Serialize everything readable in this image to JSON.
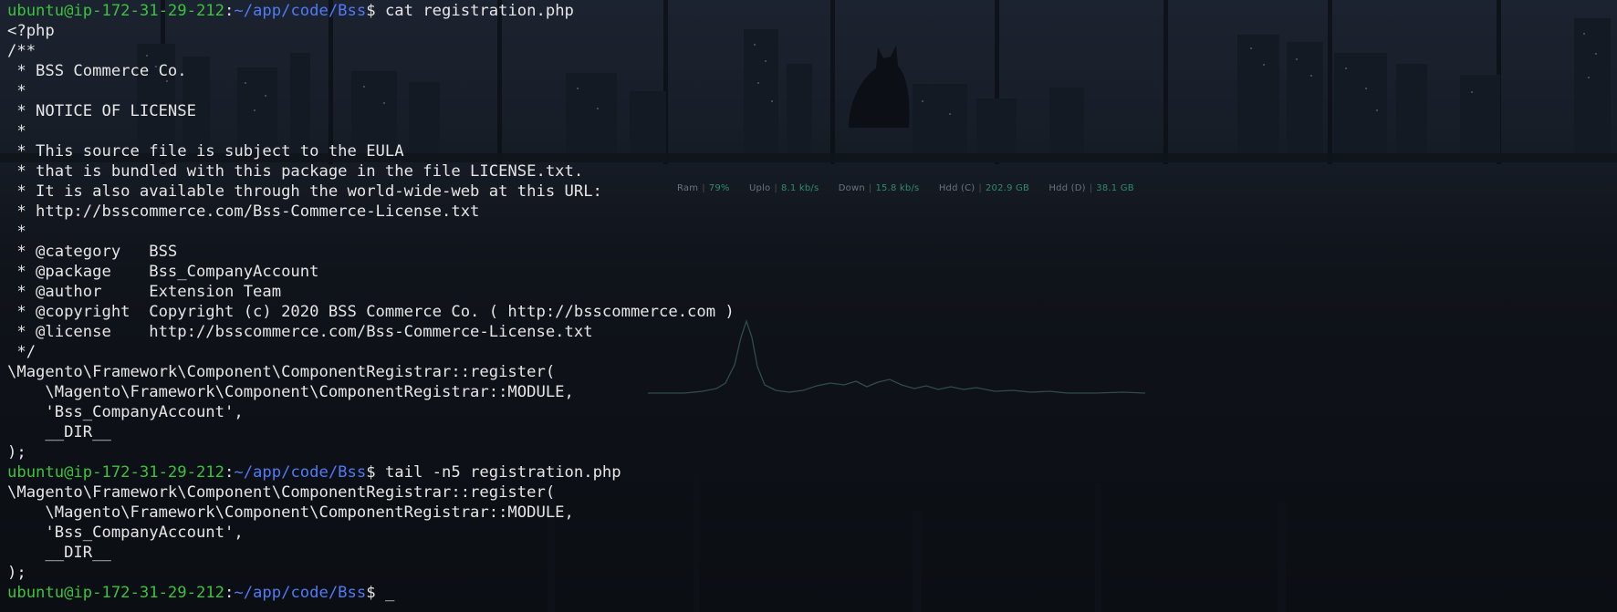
{
  "terminal": {
    "prompt": {
      "user_host": "ubuntu@ip-172-31-29-212",
      "colon": ":",
      "path": "~/app/code/Bss",
      "dollar": "$ "
    },
    "lines": [
      {
        "type": "prompt",
        "command": "cat registration.php"
      },
      {
        "type": "out",
        "text": "<?php"
      },
      {
        "type": "out",
        "text": "/**"
      },
      {
        "type": "out",
        "text": " * BSS Commerce Co."
      },
      {
        "type": "out",
        "text": " *"
      },
      {
        "type": "out",
        "text": " * NOTICE OF LICENSE"
      },
      {
        "type": "out",
        "text": " *"
      },
      {
        "type": "out",
        "text": " * This source file is subject to the EULA"
      },
      {
        "type": "out",
        "text": " * that is bundled with this package in the file LICENSE.txt."
      },
      {
        "type": "out",
        "text": " * It is also available through the world-wide-web at this URL:"
      },
      {
        "type": "out",
        "text": " * http://bsscommerce.com/Bss-Commerce-License.txt"
      },
      {
        "type": "out",
        "text": " *"
      },
      {
        "type": "out",
        "text": " * @category   BSS"
      },
      {
        "type": "out",
        "text": " * @package    Bss_CompanyAccount"
      },
      {
        "type": "out",
        "text": " * @author     Extension Team"
      },
      {
        "type": "out",
        "text": " * @copyright  Copyright (c) 2020 BSS Commerce Co. ( http://bsscommerce.com )"
      },
      {
        "type": "out",
        "text": " * @license    http://bsscommerce.com/Bss-Commerce-License.txt"
      },
      {
        "type": "out",
        "text": " */"
      },
      {
        "type": "out",
        "text": "\\Magento\\Framework\\Component\\ComponentRegistrar::register("
      },
      {
        "type": "out",
        "text": "    \\Magento\\Framework\\Component\\ComponentRegistrar::MODULE,"
      },
      {
        "type": "out",
        "text": "    'Bss_CompanyAccount',"
      },
      {
        "type": "out",
        "text": "    __DIR__"
      },
      {
        "type": "out",
        "text": ");"
      },
      {
        "type": "prompt",
        "command": "tail -n5 registration.php"
      },
      {
        "type": "out",
        "text": "\\Magento\\Framework\\Component\\ComponentRegistrar::register("
      },
      {
        "type": "out",
        "text": "    \\Magento\\Framework\\Component\\ComponentRegistrar::MODULE,"
      },
      {
        "type": "out",
        "text": "    'Bss_CompanyAccount',"
      },
      {
        "type": "out",
        "text": "    __DIR__"
      },
      {
        "type": "out",
        "text": ");"
      },
      {
        "type": "prompt",
        "command": "",
        "cursor": "_"
      }
    ]
  },
  "system_monitor": {
    "metrics": [
      {
        "label": "Ram",
        "value": "79%"
      },
      {
        "label": "Uplo",
        "value": "8.1 kb/s"
      },
      {
        "label": "Down",
        "value": "15.8 kb/s"
      },
      {
        "label": "Hdd (C)",
        "value": "202.9 GB"
      },
      {
        "label": "Hdd (D)",
        "value": "38.1 GB"
      }
    ]
  },
  "colors": {
    "prompt_user": "#3cc23c",
    "prompt_path": "#4f7bf5",
    "text": "#e6e6e6",
    "monitor_value": "#2f8a72",
    "background": "#0d1017"
  }
}
